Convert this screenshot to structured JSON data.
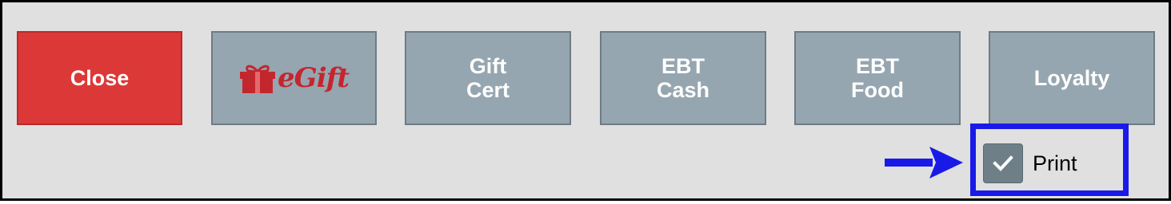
{
  "buttons": {
    "close": "Close",
    "egift": "eGift",
    "gift_cert": [
      "Gift",
      "Cert"
    ],
    "ebt_cash": [
      "EBT",
      "Cash"
    ],
    "ebt_food": [
      "EBT",
      "Food"
    ],
    "loyalty": "Loyalty"
  },
  "print": {
    "label": "Print",
    "checked": true
  },
  "annotation": {
    "arrow_icon": "right-arrow-icon",
    "highlight_color": "#1a1ae8"
  },
  "colors": {
    "close_button": "#dc3838",
    "button": "#96a6b0",
    "egift_brand": "#c4262e",
    "background": "#e0e0e0"
  }
}
